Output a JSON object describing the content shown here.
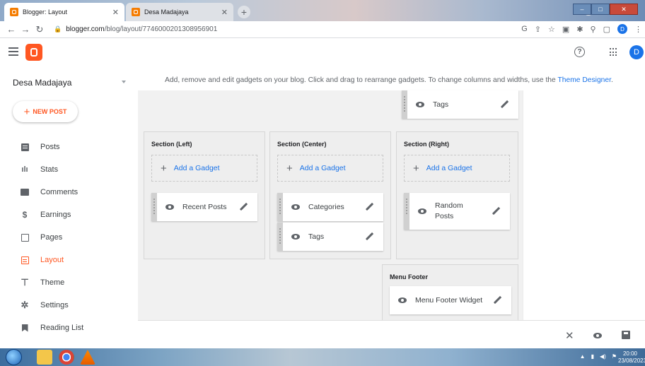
{
  "browser": {
    "tabs": [
      {
        "title": "Blogger: Layout",
        "active": true
      },
      {
        "title": "Desa Madajaya",
        "active": false
      }
    ],
    "url_host": "blogger.com",
    "url_path": "/blog/layout/7746000201308956901",
    "profile_initial": "D"
  },
  "header": {
    "avatar_initial": "D",
    "help_symbol": "?"
  },
  "sidebar": {
    "blog_name": "Desa Madajaya",
    "new_post_label": "NEW POST",
    "items": [
      {
        "label": "Posts",
        "icon": "posts-icon"
      },
      {
        "label": "Stats",
        "icon": "stats-icon"
      },
      {
        "label": "Comments",
        "icon": "comments-icon"
      },
      {
        "label": "Earnings",
        "icon": "earnings-icon"
      },
      {
        "label": "Pages",
        "icon": "pages-icon"
      },
      {
        "label": "Layout",
        "icon": "layout-icon",
        "active": true
      },
      {
        "label": "Theme",
        "icon": "theme-icon"
      },
      {
        "label": "Settings",
        "icon": "settings-icon"
      },
      {
        "label": "Reading List",
        "icon": "reading-list-icon"
      }
    ]
  },
  "main": {
    "info_text": "Add, remove and edit gadgets on your blog. Click and drag to rearrange gadgets. To change columns and widths, use the",
    "info_link": "Theme Designer",
    "info_end": ".",
    "top_gadget": "Tags",
    "add_gadget_label": "Add a Gadget",
    "sections": {
      "left": {
        "title": "Section (Left)",
        "gadgets": [
          "Recent Posts"
        ]
      },
      "center": {
        "title": "Section (Center)",
        "gadgets": [
          "Categories",
          "Tags"
        ]
      },
      "right": {
        "title": "Section (Right)",
        "gadgets": [
          "Random Posts"
        ]
      },
      "footer": {
        "title": "Menu Footer",
        "gadgets": [
          "Menu Footer Widget"
        ]
      }
    }
  },
  "actionbar": {
    "close_symbol": "✕"
  },
  "taskbar": {
    "time": "20:00",
    "date": "23/08/2023"
  },
  "colors": {
    "accent": "#ff5722",
    "link": "#1a73e8",
    "canvas": "#f1f1f1"
  }
}
